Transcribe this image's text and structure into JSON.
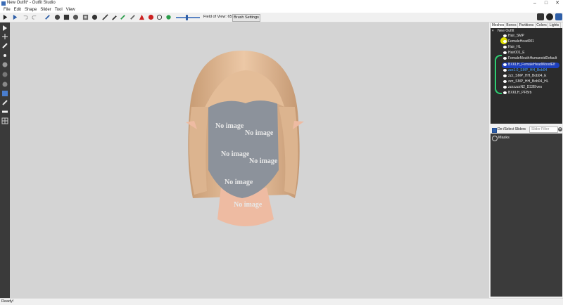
{
  "window": {
    "title": "New Outfit* - Outfit Studio"
  },
  "menu": [
    "File",
    "Edit",
    "Shape",
    "Slider",
    "Tool",
    "View"
  ],
  "toolbar": {
    "fov_label": "Field of View: 65",
    "fov_value": 65,
    "brush_settings": "Brush Settings"
  },
  "tabs": [
    "Meshes",
    "Bones",
    "Partitions",
    "Colors",
    "Lights"
  ],
  "tree": {
    "root": "New Outfit",
    "items": [
      "Hair_SMP",
      "FemaleHead001",
      "Hair_HL",
      "Hair001_E",
      "FemaleMouthHumanoidDefault",
      "BXKLH_FemaleHeadWoodElf",
      "zzz1.0_SMP_HH_Bob04",
      "zzz_SMP_HH_Bob04_E",
      "zzz_SMP_HH_Bob04_HL",
      "zzzzzzzN2_D32Elves",
      "BXKLH_PFBrb"
    ],
    "selected_index": 5
  },
  "slider_panel": {
    "checkbox_label": "De-/Select Sliders",
    "filter_placeholder": "Slider Filter",
    "items": [
      "Masks"
    ]
  },
  "viewport": {
    "texture_text": "No image"
  },
  "status": "Ready!",
  "colors": {
    "accent": "#2f5fa8",
    "tree_bg": "#2c2c2c",
    "viewport_bg": "#d4d4d4",
    "selection": "#1d3fbf",
    "annotation_green": "#2ecc71",
    "annotation_yellow": "#e0e000"
  }
}
